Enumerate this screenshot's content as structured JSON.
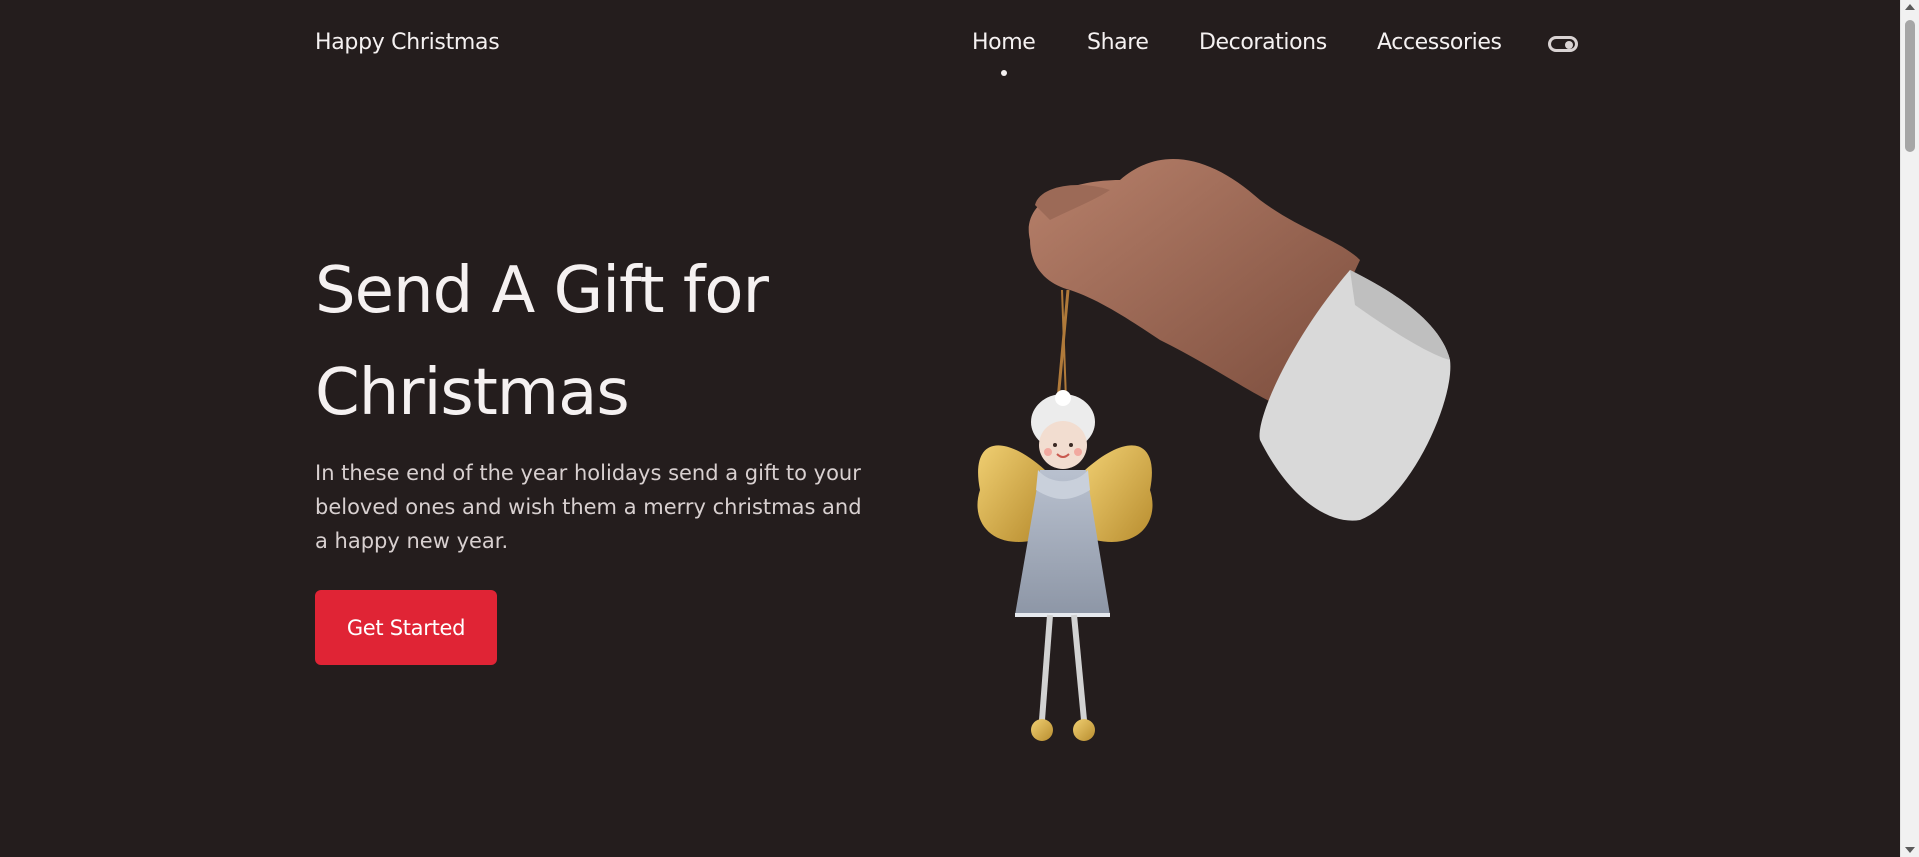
{
  "header": {
    "logo": "Happy Christmas",
    "nav": [
      {
        "label": "Home",
        "active": true
      },
      {
        "label": "Share",
        "active": false
      },
      {
        "label": "Decorations",
        "active": false
      },
      {
        "label": "Accessories",
        "active": false
      }
    ],
    "theme_toggle_icon": "toggle-switch-icon"
  },
  "hero": {
    "title_line1": "Send A Gift for",
    "title_line2": "Christmas",
    "description": "In these end of the year holidays send a gift to your beloved ones and wish them a merry christmas and a happy new year.",
    "cta_label": "Get Started",
    "image_icon": "hand-holding-angel-ornament"
  },
  "colors": {
    "background": "#241d1d",
    "accent": "#e02435",
    "text": "#f5f1f1"
  }
}
